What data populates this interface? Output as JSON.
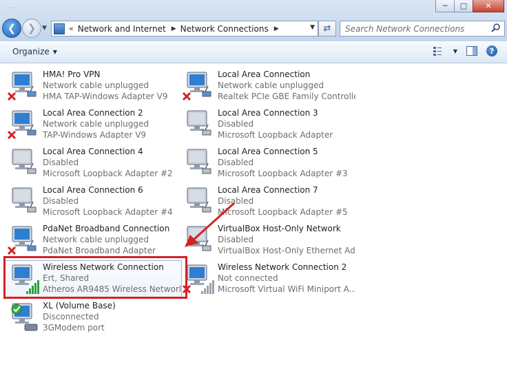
{
  "window": {
    "title": "...",
    "minimize": "─",
    "maximize": "□",
    "close": "✕"
  },
  "address_bar": {
    "crumbs": [
      "Network and Internet",
      "Network Connections"
    ],
    "overflow": "«"
  },
  "search": {
    "placeholder": "Search Network Connections"
  },
  "toolbar": {
    "organize_label": "Organize"
  },
  "connections": [
    {
      "name": "HMA! Pro VPN",
      "status": "Network cable unplugged",
      "adapter": "HMA TAP-Windows Adapter V9",
      "kind": "wired",
      "state": "unplugged"
    },
    {
      "name": "Local Area Connection",
      "status": "Network cable unplugged",
      "adapter": "Realtek PCIe GBE Family Controller",
      "kind": "wired",
      "state": "unplugged"
    },
    {
      "name": "Local Area Connection 2",
      "status": "Network cable unplugged",
      "adapter": "TAP-Windows Adapter V9",
      "kind": "wired",
      "state": "unplugged"
    },
    {
      "name": "Local Area Connection 3",
      "status": "Disabled",
      "adapter": "Microsoft Loopback Adapter",
      "kind": "wired",
      "state": "disabled"
    },
    {
      "name": "Local Area Connection 4",
      "status": "Disabled",
      "adapter": "Microsoft Loopback Adapter #2",
      "kind": "wired",
      "state": "disabled"
    },
    {
      "name": "Local Area Connection 5",
      "status": "Disabled",
      "adapter": "Microsoft Loopback Adapter #3",
      "kind": "wired",
      "state": "disabled"
    },
    {
      "name": "Local Area Connection 6",
      "status": "Disabled",
      "adapter": "Microsoft Loopback Adapter #4",
      "kind": "wired",
      "state": "disabled"
    },
    {
      "name": "Local Area Connection 7",
      "status": "Disabled",
      "adapter": "Microsoft Loopback Adapter #5",
      "kind": "wired",
      "state": "disabled"
    },
    {
      "name": "PdaNet Broadband Connection",
      "status": "Network cable unplugged",
      "adapter": "PdaNet Broadband Adapter",
      "kind": "wired",
      "state": "unplugged"
    },
    {
      "name": "VirtualBox Host-Only Network",
      "status": "Disabled",
      "adapter": "VirtualBox Host-Only Ethernet Ad...",
      "kind": "wired",
      "state": "disabled"
    },
    {
      "name": "Wireless Network Connection",
      "status": "Ert, Shared",
      "adapter": "Atheros AR9485 Wireless Network...",
      "kind": "wireless",
      "state": "connected"
    },
    {
      "name": "Wireless Network Connection 2",
      "status": "Not connected",
      "adapter": "Microsoft Virtual WiFi Miniport A...",
      "kind": "wireless",
      "state": "notconnected"
    },
    {
      "name": "XL (Volume Base)",
      "status": "Disconnected",
      "adapter": "3GModem port",
      "kind": "modem",
      "state": "ok"
    }
  ],
  "selected_index": 10,
  "colors": {
    "annotation": "#d61f26",
    "accent": "#1f5fb8"
  }
}
